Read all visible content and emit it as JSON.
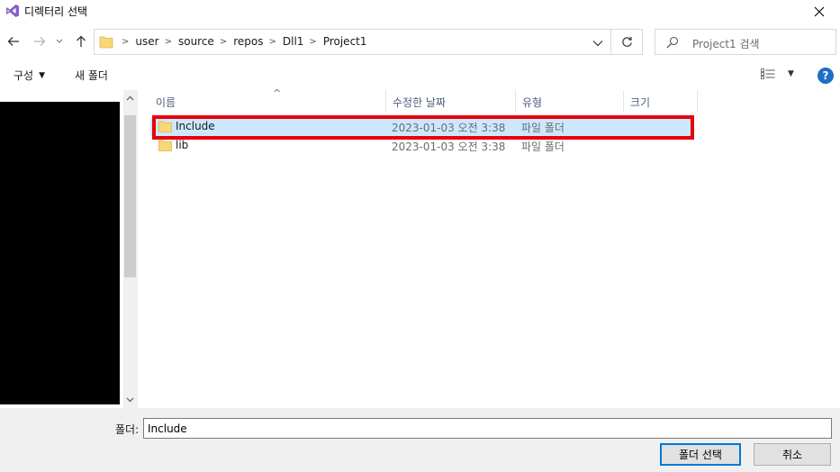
{
  "window": {
    "title": "디렉터리 선택",
    "close_label": "✕"
  },
  "nav": {
    "back_glyph": "←",
    "forward_glyph": "→",
    "recent_glyph": "⌄",
    "up_glyph": "↑",
    "breadcrumbs": [
      "user",
      "source",
      "repos",
      "Dll1",
      "Project1"
    ],
    "separator": ">",
    "dropdown_glyph": "⌄",
    "refresh_glyph": "↻"
  },
  "search": {
    "placeholder": "Project1 검색"
  },
  "toolbar": {
    "organize_label": "구성",
    "organize_caret": "▼",
    "new_folder_label": "새 폴더",
    "view_caret": "▼",
    "help_label": "?"
  },
  "columns": {
    "name": "이름",
    "date": "수정한 날짜",
    "type": "유형",
    "size": "크기",
    "sort_indicator": "^"
  },
  "files": [
    {
      "name": "Include",
      "date": "2023-01-03 오전 3:38",
      "type": "파일 폴더",
      "selected": true
    },
    {
      "name": "lib",
      "date": "2023-01-03 오전 3:38",
      "type": "파일 폴더",
      "selected": false
    }
  ],
  "navpane": {
    "scroll_up": "˄",
    "scroll_down": "˅"
  },
  "bottom": {
    "folder_label": "폴더:",
    "folder_value": "Include",
    "select_button": "폴더 선택",
    "cancel_button": "취소"
  },
  "colors": {
    "selection": "#cce8ff",
    "highlight": "#e8000b",
    "accent": "#0078d7",
    "vs_purple": "#865fc5"
  }
}
